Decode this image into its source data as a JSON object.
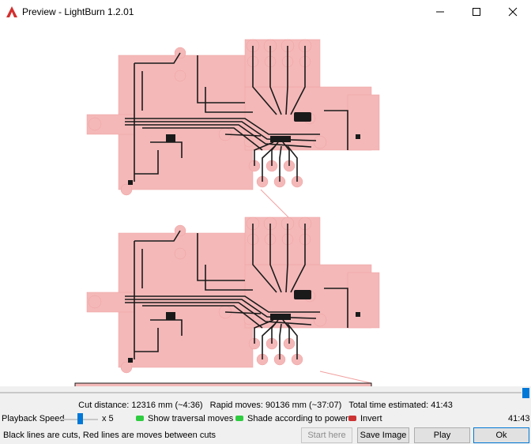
{
  "window": {
    "title": "Preview - LightBurn 1.2.01",
    "icon": "lightburn-logo-icon",
    "controls": [
      "minimize-icon",
      "maximize-icon",
      "close-icon"
    ]
  },
  "preview": {
    "background": "#ffffff",
    "pad_color": "#f4b8b8",
    "trace_color": "#1a1a1a",
    "board_count": 2
  },
  "stats": {
    "cut_distance": "Cut distance: 12316 mm (~4:36)",
    "rapid_moves": "Rapid moves: 90136 mm (~37:07)",
    "total_time": "Total time estimated: 41:43"
  },
  "controls": {
    "playback_label": "Playback Speed",
    "speed_multiplier": "x 5",
    "show_traversal": {
      "label": "Show traversal moves",
      "on": true
    },
    "shade_power": {
      "label": "Shade according to power",
      "on": true
    },
    "invert": {
      "label": "Invert",
      "on": false
    },
    "elapsed_time": "41:43",
    "playback_progress": 1.0
  },
  "statusbar": {
    "hint": "Black lines are cuts, Red lines are moves between cuts"
  },
  "buttons": {
    "start_here": "Start here",
    "save_image": "Save Image",
    "play": "Play",
    "ok": "Ok"
  },
  "colors": {
    "accent": "#0078d7",
    "toggle_on": "#2ecc40",
    "toggle_off": "#cc3333"
  }
}
